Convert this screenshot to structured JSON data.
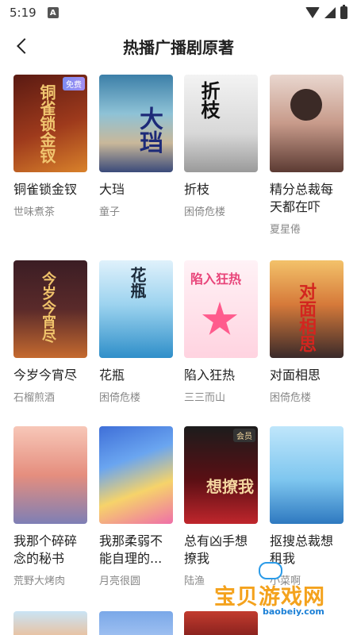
{
  "status_bar": {
    "time": "5:19",
    "app_icon": "A"
  },
  "header": {
    "title": "热播广播剧原著"
  },
  "books": [
    {
      "title": "铜雀锁金钗",
      "author": "世味煮茶",
      "badge": "免费",
      "cover_text": "铜雀锁金钗",
      "icon": "book-cover"
    },
    {
      "title": "大珰",
      "author": "童子",
      "badge": "",
      "cover_text": "大珰",
      "icon": "book-cover"
    },
    {
      "title": "折枝",
      "author": "困倚危楼",
      "badge": "",
      "cover_text": "折枝",
      "icon": "book-cover"
    },
    {
      "title": "精分总裁每天都在吓",
      "author": "夏星倦",
      "badge": "",
      "cover_text": "",
      "icon": "book-cover"
    },
    {
      "title": "今岁今宵尽",
      "author": "石榴煎酒",
      "badge": "",
      "cover_text": "今岁今宵尽",
      "icon": "book-cover"
    },
    {
      "title": "花瓶",
      "author": "困倚危楼",
      "badge": "",
      "cover_text": "花瓶",
      "icon": "book-cover"
    },
    {
      "title": "陷入狂热",
      "author": "三三而山",
      "badge": "",
      "cover_text": "陷入狂热",
      "icon": "book-cover"
    },
    {
      "title": "对面相思",
      "author": "困倚危楼",
      "badge": "",
      "cover_text": "对面相思",
      "icon": "book-cover"
    },
    {
      "title": "我那个碎碎念的秘书",
      "author": "荒野大烤肉",
      "badge": "",
      "cover_text": "",
      "icon": "book-cover"
    },
    {
      "title": "我那柔弱不能自理的...",
      "author": "月亮很圆",
      "badge": "",
      "cover_text": "",
      "icon": "book-cover"
    },
    {
      "title": "总有凶手想撩我",
      "author": "陆渔",
      "badge": "会员",
      "cover_text": "想撩我",
      "icon": "book-cover"
    },
    {
      "title": "抠搜总裁想租我",
      "author": "小菜啊",
      "badge": "",
      "cover_text": "",
      "icon": "book-cover"
    }
  ],
  "watermark": {
    "text": "宝贝游戏网",
    "url": "baobeiy.com"
  },
  "colors": {
    "badge_free": "#8f8df0",
    "badge_vip": "#333333",
    "author_gray": "#888888"
  }
}
